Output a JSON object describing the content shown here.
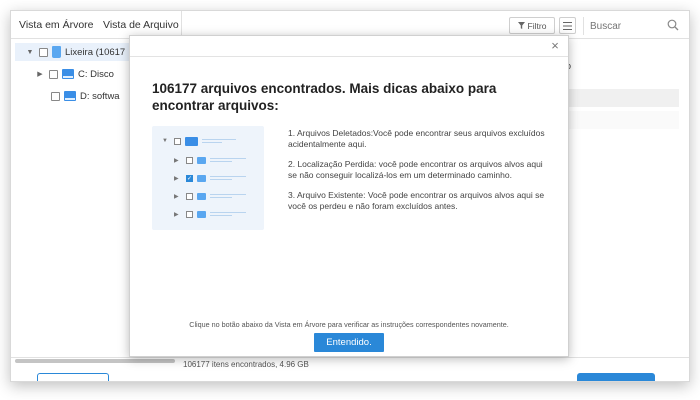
{
  "toolbar": {
    "tab_tree": "Vista em Árvore",
    "tab_files": "Vista de Arquivo",
    "filter_label": "Filtro",
    "search_placeholder": "Buscar"
  },
  "tree": {
    "items": [
      {
        "label": "Lixeira (10617"
      },
      {
        "label": "C: Disco"
      },
      {
        "label": "D: softwa"
      }
    ]
  },
  "main": {
    "column_fragment": "no"
  },
  "status": {
    "text": "106177 itens encontrados, 4.96 GB"
  },
  "dialog": {
    "close": "×",
    "title": "106177 arquivos encontrados. Mais dicas abaixo para encontrar arquivos:",
    "tips": [
      "1. Arquivos Deletados:Você pode encontrar seus arquivos excluídos acidentalmente aqui.",
      "2. Localização Perdida: você pode encontrar os arquivos alvos aqui se não conseguir localizá-los em um determinado caminho.",
      "3. Arquivo Existente: Você pode encontrar os arquivos alvos aqui se você os perdeu e não foram excluídos antes."
    ],
    "footer_note": "Clique no botão abaixo da Vista em Árvore para verificar as instruções correspondentes novamente.",
    "ok_label": "Entendido."
  },
  "colors": {
    "accent": "#2a88d8",
    "illustration_bg": "#eef4fb"
  }
}
